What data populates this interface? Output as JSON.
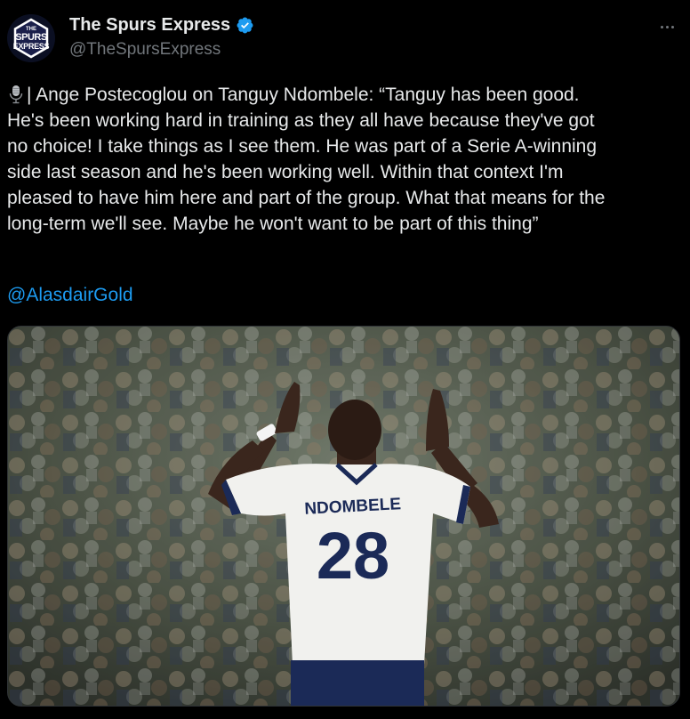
{
  "account": {
    "display_name": "The Spurs Express",
    "handle": "@TheSpursExpress",
    "avatar_text": [
      "THE",
      "SPURS",
      "EXPRESS"
    ]
  },
  "tweet": {
    "lines": [
      "| Ange Postecoglou on Tanguy Ndombele: “Tanguy has been good.",
      "He's been working hard in training as they all have because they've got",
      "no choice! I take things as I see them. He was part of a Serie A-winning",
      "side last season and he's been working well. Within that context I'm",
      "pleased to have him here and part of the group. What that means for the",
      "long-term we'll see. Maybe he won't want to be part of this thing”"
    ],
    "mention": "@AlasdairGold"
  },
  "media": {
    "jersey_name": "NDOMBELE",
    "jersey_number": "28"
  },
  "colors": {
    "background": "#000000",
    "text": "#e7e9ea",
    "secondary": "#71767b",
    "link": "#1d9bf0",
    "verified": "#1d9bf0",
    "avatar_bg": "#1a1f4a"
  },
  "icons": [
    "microphone-icon",
    "verified-badge-icon",
    "more-options-icon"
  ]
}
